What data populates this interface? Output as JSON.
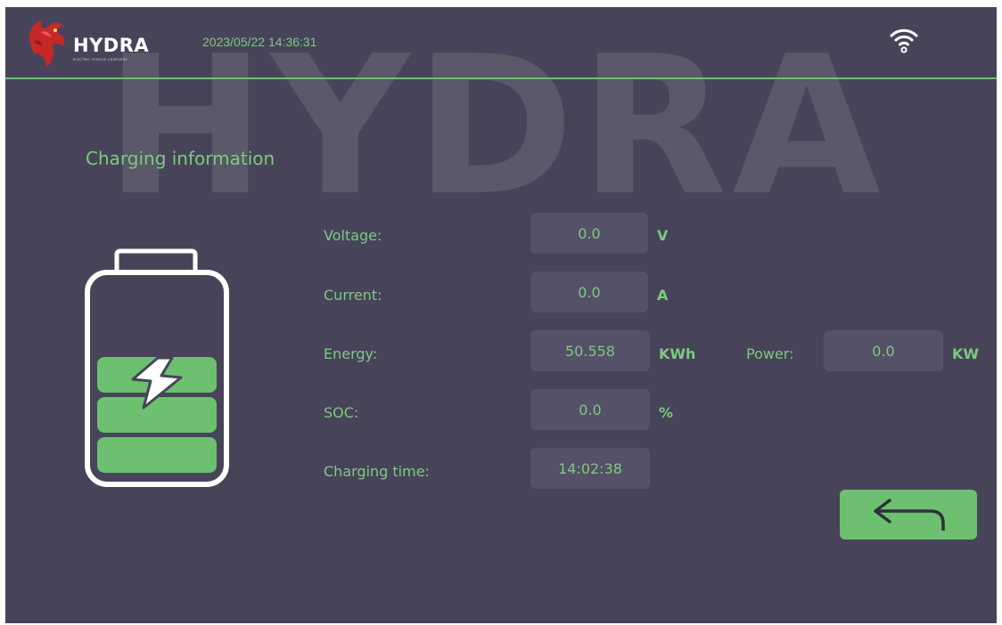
{
  "brand": {
    "name": "HYDRA",
    "tagline": "ELECTRIC VEHICLE CHARGERS",
    "watermark": "HYDRA"
  },
  "header": {
    "datetime": "2023/05/22 14:36:31",
    "wifi_icon": "wifi-icon"
  },
  "section_title": "Charging information",
  "readings": {
    "voltage": {
      "label": "Voltage:",
      "value": "0.0",
      "unit": "V"
    },
    "current": {
      "label": "Current:",
      "value": "0.0",
      "unit": "A"
    },
    "energy": {
      "label": "Energy:",
      "value": "50.558",
      "unit": "KWh"
    },
    "power": {
      "label": "Power:",
      "value": "0.0",
      "unit": "KW"
    },
    "soc": {
      "label": "SOC:",
      "value": "0.0",
      "unit": "%"
    },
    "charging_time": {
      "label": "Charging time:",
      "value": "14:02:38"
    }
  },
  "battery": {
    "icon": "battery-charging-icon",
    "filled_segments": 3,
    "total_segments": 3
  },
  "back_button": {
    "icon": "back-arrow-icon"
  },
  "colors": {
    "background": "#47445a",
    "accent": "#7ec97e",
    "button": "#6cc06f",
    "value_box": "#545168"
  }
}
